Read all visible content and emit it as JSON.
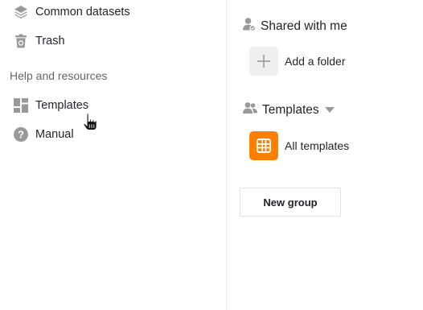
{
  "sidebar": {
    "items": [
      {
        "label": "Common datasets",
        "icon": "layers-icon"
      },
      {
        "label": "Trash",
        "icon": "trash-icon"
      }
    ],
    "help_section_title": "Help and resources",
    "help_items": [
      {
        "label": "Templates",
        "icon": "templates-icon"
      },
      {
        "label": "Manual",
        "icon": "help-circle-icon"
      }
    ]
  },
  "main": {
    "shared_group": {
      "title": "Shared with me",
      "add_folder_label": "Add a folder"
    },
    "templates_group": {
      "title": "Templates",
      "all_templates_label": "All templates"
    },
    "new_group_label": "New group"
  },
  "colors": {
    "icon_gray": "#999999",
    "accent_orange": "#ff8000"
  }
}
